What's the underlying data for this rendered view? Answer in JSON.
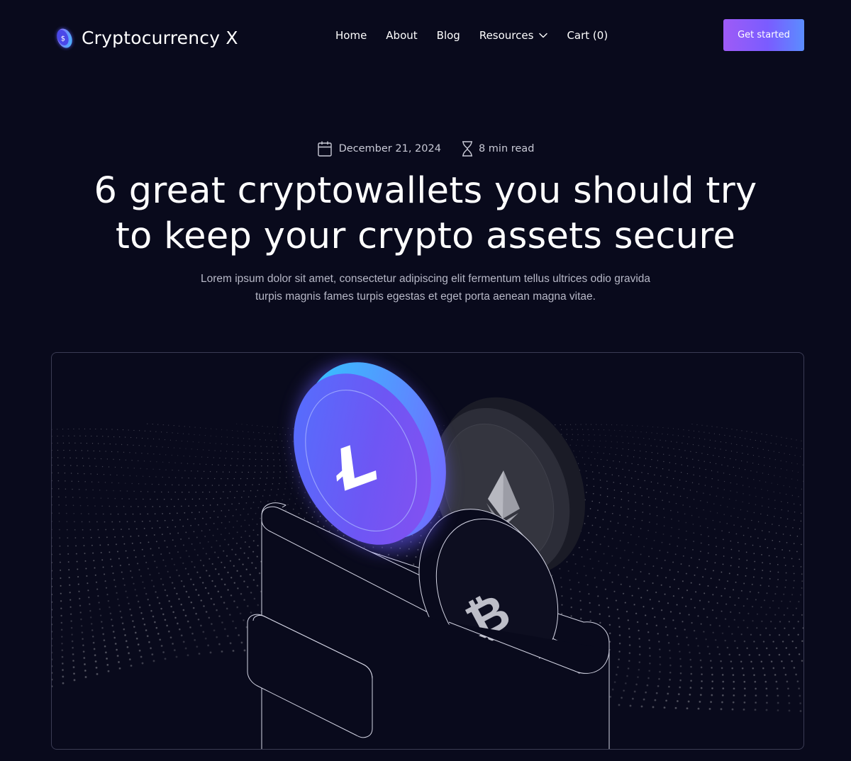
{
  "brand": {
    "name": "Cryptocurrency X",
    "logo_icon": "coin-dollar-icon"
  },
  "nav": {
    "items": [
      "Home",
      "About",
      "Blog",
      "Resources",
      "Cart (0)"
    ],
    "dropdown_icon": "chevron-down-icon"
  },
  "cta": {
    "label": "Get started"
  },
  "article": {
    "date": "December 21, 2024",
    "read_time": "8 min read",
    "date_icon": "calendar-icon",
    "read_time_icon": "hourglass-icon",
    "title": "6 great cryptowallets you should try to keep your crypto assets secure",
    "subtitle": "Lorem ipsum dolor sit amet, consectetur adipiscing elit fermentum tellus ultrices odio gravida turpis magnis fames turpis egestas et eget porta aenean magna vitae."
  },
  "hero_image": {
    "subject": "wallet with litecoin, ethereum and bitcoin coins",
    "icons": [
      "litecoin-icon",
      "ethereum-icon",
      "bitcoin-icon"
    ]
  },
  "colors": {
    "background": "#090a1c",
    "accent_start": "#9e5bf6",
    "accent_end": "#5b8dff",
    "text": "#ffffff",
    "muted_text": "#b7b8c7",
    "border": "#3b3c54"
  }
}
